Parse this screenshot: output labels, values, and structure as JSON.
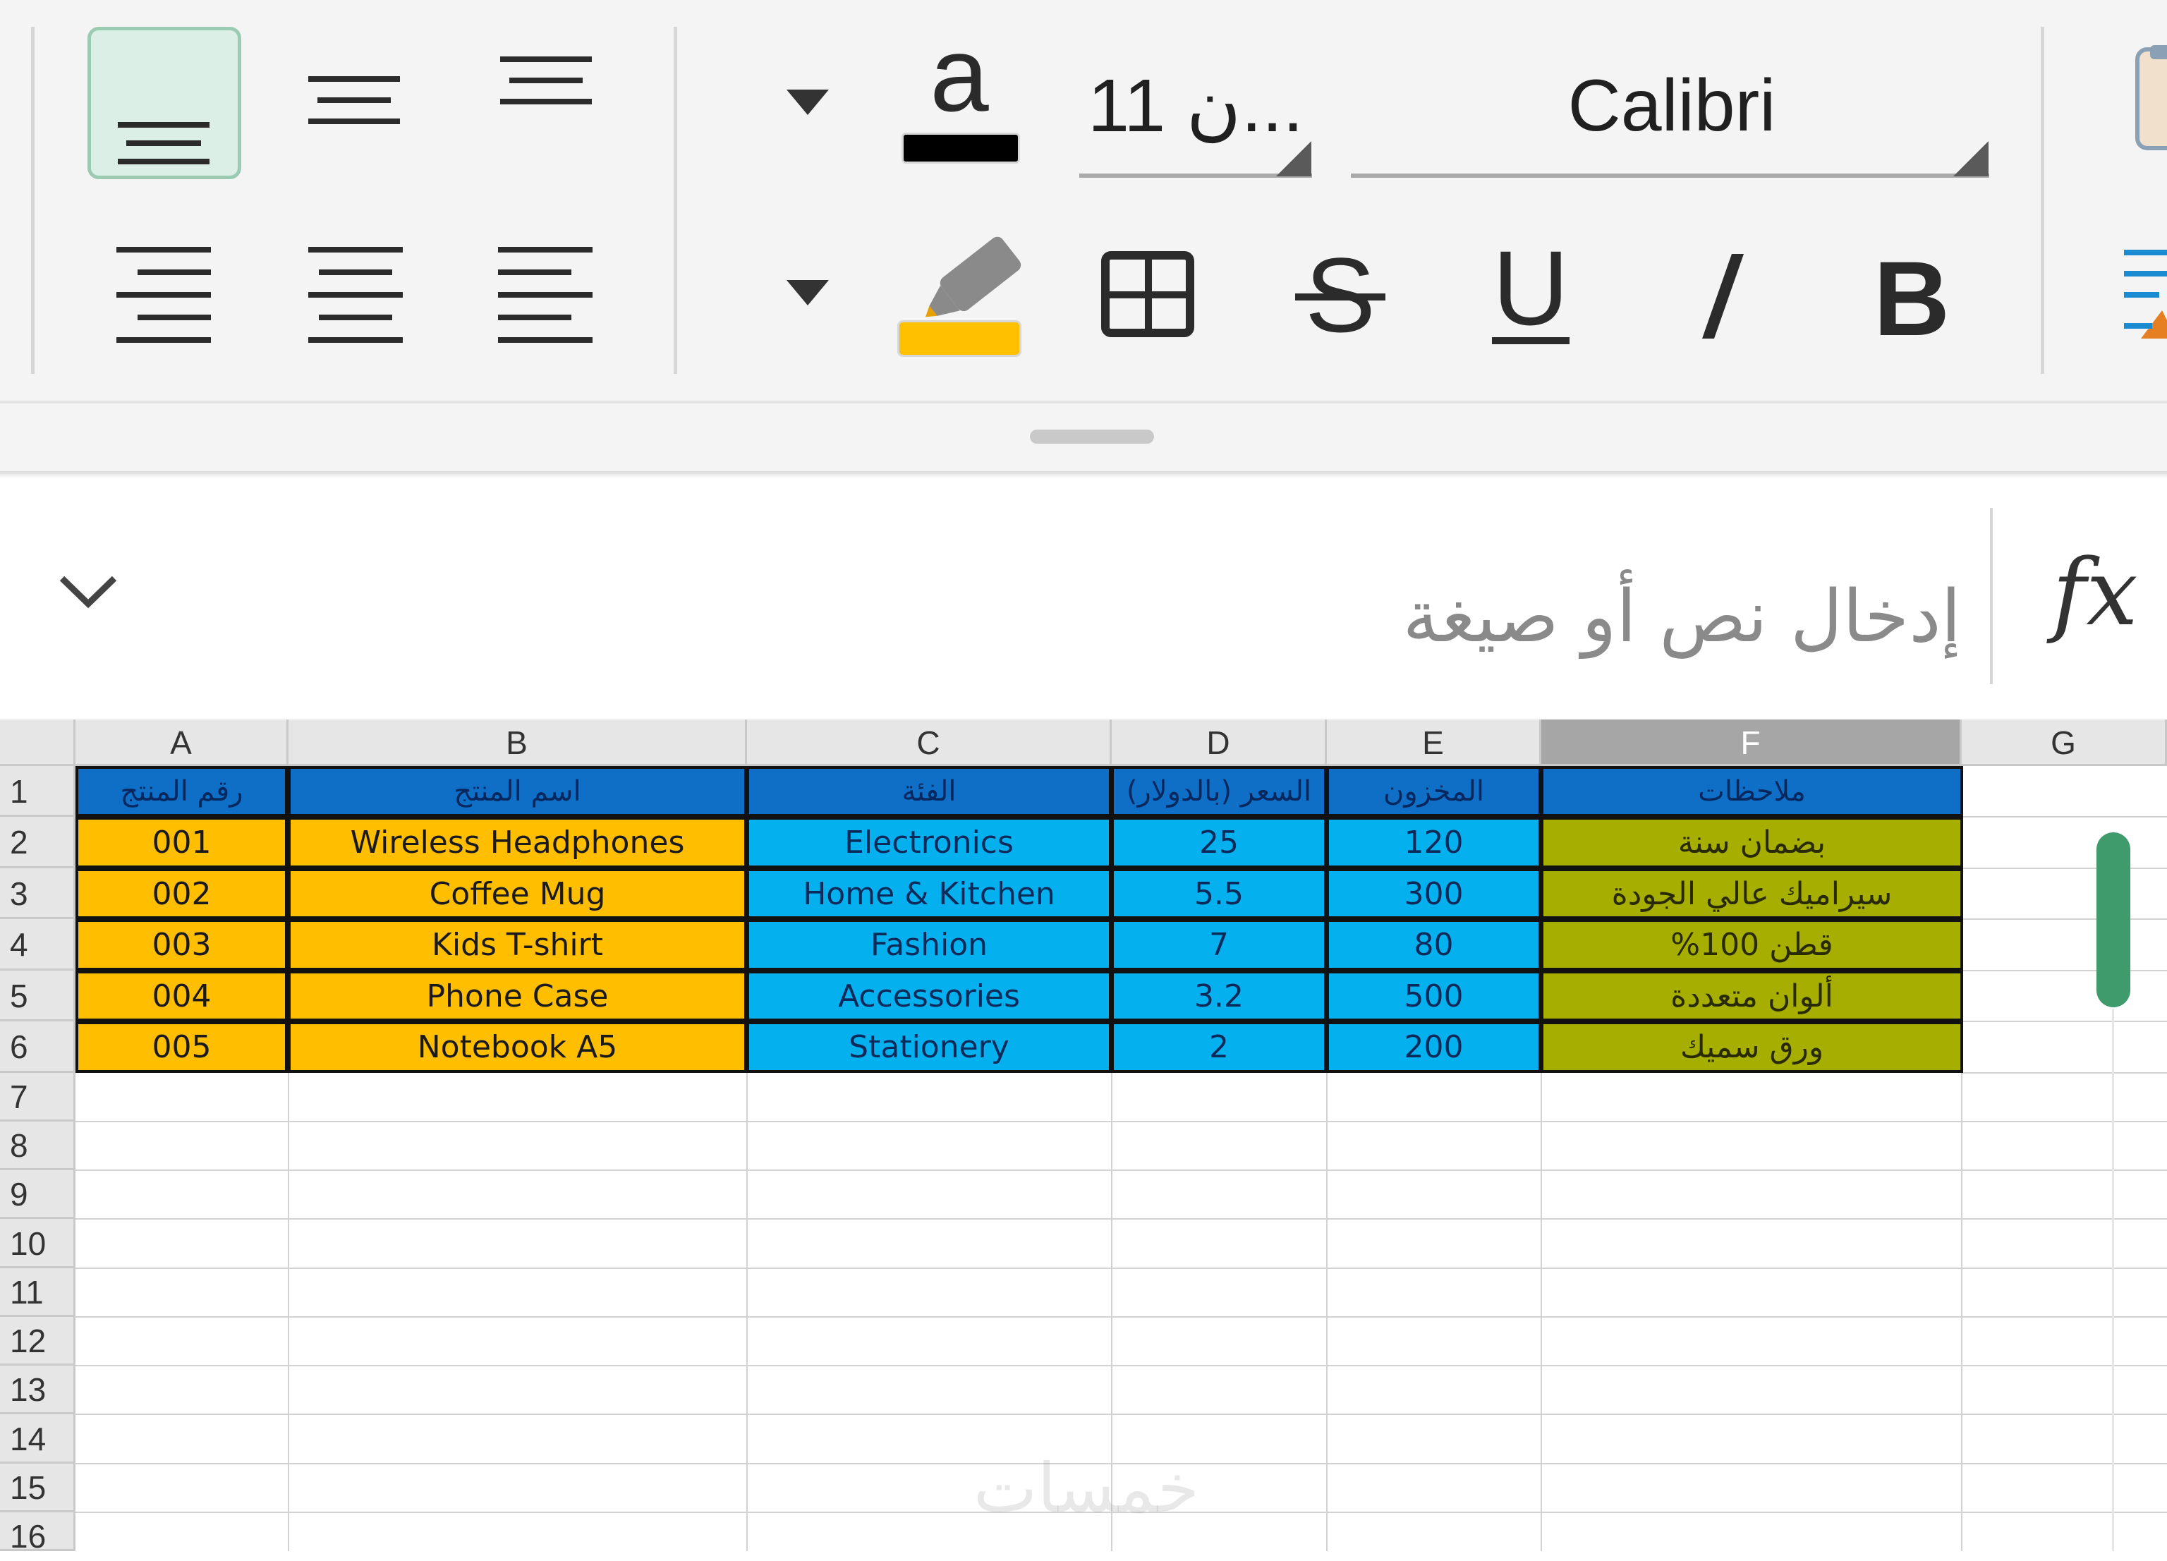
{
  "toolbar": {
    "font_size": "11 ن...",
    "font_name": "Calibri",
    "font_color_glyph": "a",
    "colors": {
      "font_color": "#000000",
      "highlight": "#ffc000",
      "active_align_bg": "#dcefe6",
      "active_align_border": "#9ccbb3"
    }
  },
  "formula_bar": {
    "placeholder": "إدخال نص أو صيغة",
    "fx_label": "fx"
  },
  "grid": {
    "column_headers": [
      "A",
      "B",
      "C",
      "D",
      "E",
      "F",
      "G"
    ],
    "selected_column": "F",
    "row_numbers": [
      "1",
      "2",
      "3",
      "4",
      "5",
      "6",
      "7",
      "8",
      "9",
      "10",
      "11",
      "12",
      "13",
      "14",
      "15",
      "16"
    ],
    "header_row": [
      "رقم المنتج",
      "اسم المنتج",
      "الفئة",
      "السعر (بالدولار)",
      "المخزون",
      "ملاحظات"
    ],
    "rows": [
      [
        "001",
        "Wireless Headphones",
        "Electronics",
        "25",
        "120",
        "بضمان سنة"
      ],
      [
        "002",
        "Coffee Mug",
        "Home & Kitchen",
        "5.5",
        "300",
        "سيراميك عالي الجودة"
      ],
      [
        "003",
        "Kids T-shirt",
        "Fashion",
        "7",
        "80",
        "قطن 100%"
      ],
      [
        "004",
        "Phone Case",
        "Accessories",
        "3.2",
        "500",
        "ألوان متعددة"
      ],
      [
        "005",
        "Notebook A5",
        "Stationery",
        "2",
        "200",
        "ورق سميك"
      ]
    ],
    "colors": {
      "header_fill": "#0f6fc6",
      "col_ab_fill": "#ffbe00",
      "col_cde_fill": "#05b0ef",
      "col_f_fill": "#a6ae00"
    }
  },
  "watermark": "خمسات"
}
